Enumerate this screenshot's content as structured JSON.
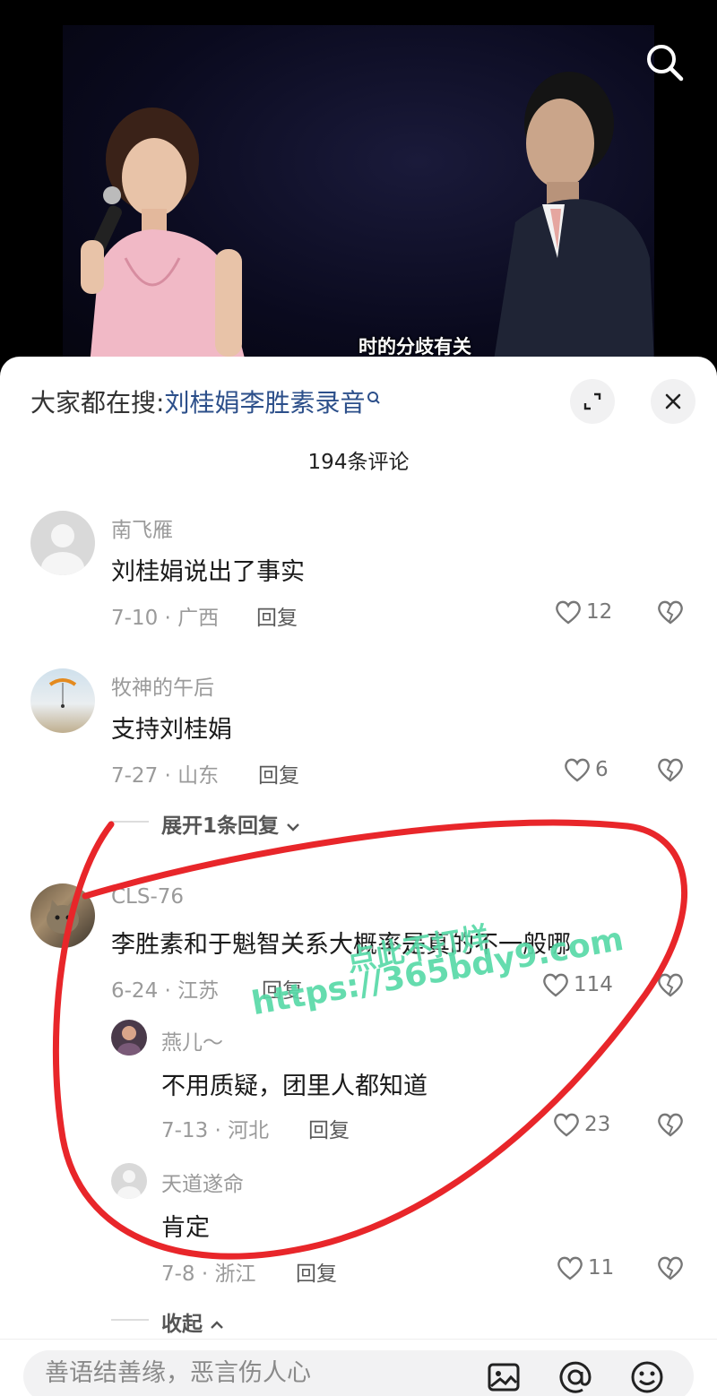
{
  "video": {
    "subtitle": "时的分歧有关",
    "search_icon": "search-icon"
  },
  "header": {
    "search_prefix": "大家都在搜:",
    "search_query": "刘桂娟李胜素录音",
    "comment_count": "194条评论"
  },
  "comments": [
    {
      "user": "南飞雁",
      "text": "刘桂娟说出了事实",
      "date_loc": "7-10 · 广西",
      "reply": "回复",
      "likes": "12"
    },
    {
      "user": "牧神的午后",
      "text": "支持刘桂娟",
      "date_loc": "7-27 · 山东",
      "reply": "回复",
      "likes": "6"
    },
    {
      "user": "CLS-76",
      "text": "李胜素和于魁智关系大概率是真的不一般哪",
      "date_loc": "6-24 · 江苏",
      "reply": "回复",
      "likes": "114"
    }
  ],
  "expand_replies": "展开1条回复",
  "replies": [
    {
      "user": "燕儿～",
      "text": "不用质疑，团里人都知道",
      "date_loc": "7-13 · 河北",
      "reply": "回复",
      "likes": "23"
    },
    {
      "user": "天道遂命",
      "text": "肯定",
      "date_loc": "7-8 · 浙江",
      "reply": "回复",
      "likes": "11"
    }
  ],
  "collapse": "收起",
  "watermark": {
    "line1": "点此不打烊",
    "line2": "https://365bdy9.com"
  },
  "input": {
    "placeholder": "善语结善缘，恶言伤人心"
  },
  "colors": {
    "annotation": "#e8262a",
    "link": "#2c4f8a",
    "watermark": "#4ad6a0"
  }
}
